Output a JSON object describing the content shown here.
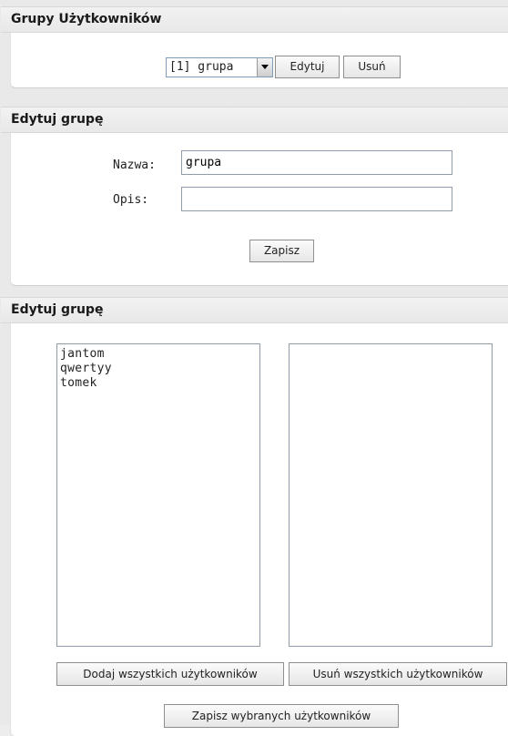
{
  "section_groups": {
    "title": "Grupy Użytkowników",
    "select_value": "[1] grupa",
    "edit_label": "Edytuj",
    "delete_label": "Usuń"
  },
  "section_edit": {
    "title": "Edytuj grupę",
    "name_label": "Nazwa:",
    "name_value": "grupa",
    "desc_label": "Opis:",
    "desc_value": "",
    "save_label": "Zapisz"
  },
  "section_members": {
    "title": "Edytuj grupę",
    "left_list": [
      "jantom",
      "qwertyy",
      "tomek"
    ],
    "right_list": [],
    "add_all_label": "Dodaj wszystkich użytkowników",
    "remove_all_label": "Usuń wszystkich użytkowników",
    "save_selected_label": "Zapisz wybranych użytkowników"
  },
  "colors": {
    "header_bg": "#ebebeb",
    "panel_bg": "#ffffff",
    "page_bg": "#e9e9e9"
  }
}
